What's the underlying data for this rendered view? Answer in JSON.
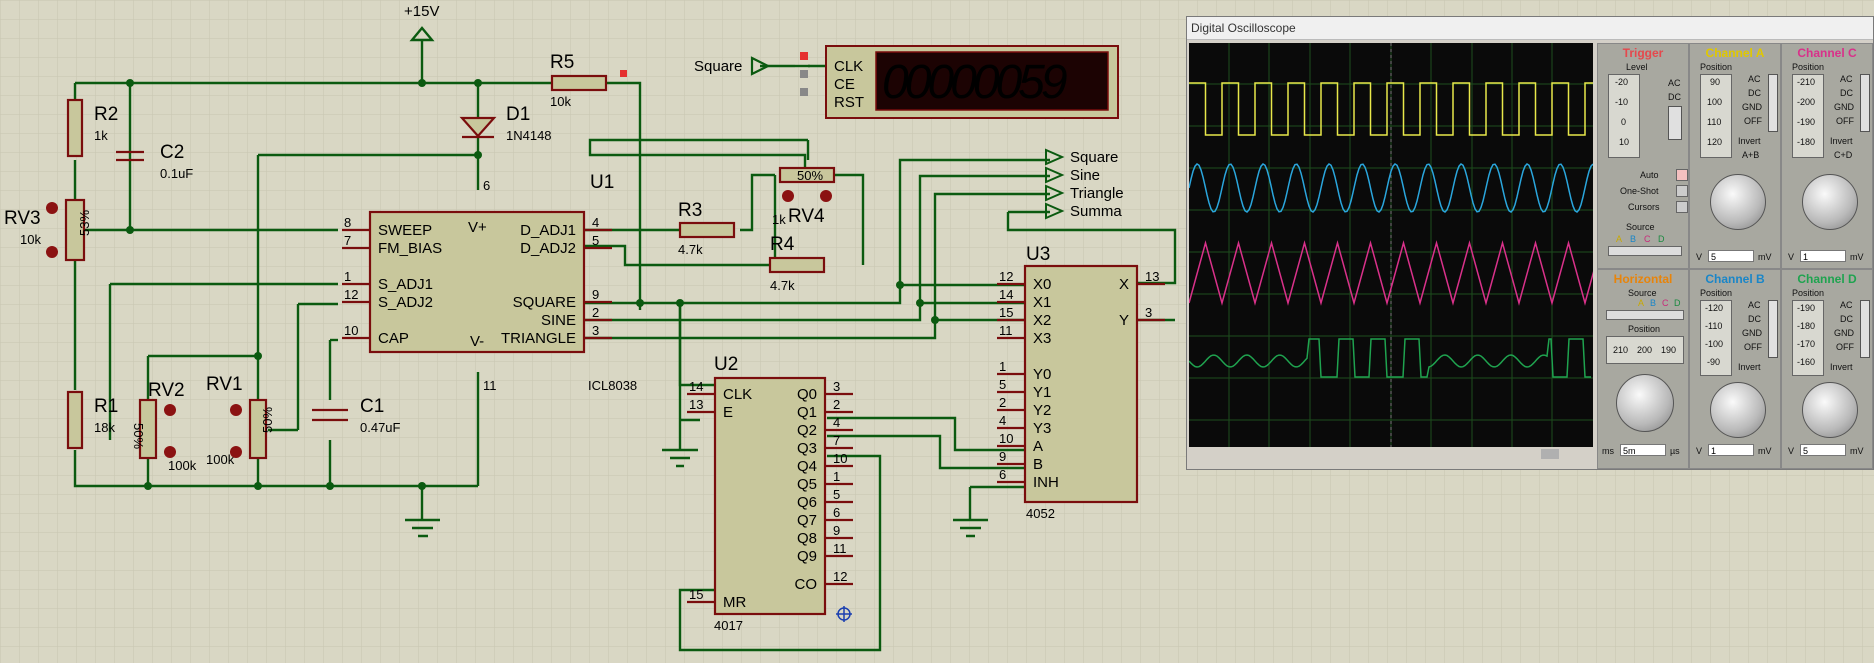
{
  "schematic": {
    "power_label": "+15V",
    "components": {
      "R2": {
        "ref": "R2",
        "value": "1k"
      },
      "C2": {
        "ref": "C2",
        "value": "0.1uF"
      },
      "RV3": {
        "ref": "RV3",
        "value": "10k",
        "wiper": "53%"
      },
      "R1": {
        "ref": "R1",
        "value": "18k"
      },
      "RV2": {
        "ref": "RV2",
        "value": "100k",
        "wiper": "50%"
      },
      "RV1": {
        "ref": "RV1",
        "value": "100k",
        "wiper": "50%"
      },
      "C1": {
        "ref": "C1",
        "value": "0.47uF"
      },
      "D1": {
        "ref": "D1",
        "value": "1N4148"
      },
      "R5": {
        "ref": "R5",
        "value": "10k"
      },
      "R3": {
        "ref": "R3",
        "value": "4.7k"
      },
      "R4": {
        "ref": "R4",
        "value": "4.7k"
      },
      "RV4": {
        "ref": "RV4",
        "value": "1k",
        "wiper": "50%"
      }
    },
    "U1": {
      "ref": "U1",
      "part": "ICL8038",
      "pins_left": [
        {
          "num": "8",
          "name": "SWEEP"
        },
        {
          "num": "7",
          "name": "FM_BIAS"
        },
        {
          "num": "1",
          "name": "S_ADJ1"
        },
        {
          "num": "12",
          "name": "S_ADJ2"
        },
        {
          "num": "10",
          "name": "CAP"
        }
      ],
      "pins_right": [
        {
          "num": "4",
          "name": "D_ADJ1"
        },
        {
          "num": "5",
          "name": "D_ADJ2"
        },
        {
          "num": "9",
          "name": "SQUARE"
        },
        {
          "num": "2",
          "name": "SINE"
        },
        {
          "num": "3",
          "name": "TRIANGLE"
        }
      ],
      "vplus": "V+",
      "vminus": "V-",
      "pin_top": "6",
      "pin_bottom": "11"
    },
    "U2": {
      "ref": "U2",
      "part": "4017",
      "pins_left": [
        {
          "num": "14",
          "name": "CLK"
        },
        {
          "num": "13",
          "name": "E"
        },
        {
          "num": "15",
          "name": "MR"
        }
      ],
      "pins_right": [
        {
          "num": "3",
          "name": "Q0"
        },
        {
          "num": "2",
          "name": "Q1"
        },
        {
          "num": "4",
          "name": "Q2"
        },
        {
          "num": "7",
          "name": "Q3"
        },
        {
          "num": "10",
          "name": "Q4"
        },
        {
          "num": "1",
          "name": "Q5"
        },
        {
          "num": "5",
          "name": "Q6"
        },
        {
          "num": "6",
          "name": "Q7"
        },
        {
          "num": "9",
          "name": "Q8"
        },
        {
          "num": "11",
          "name": "Q9"
        },
        {
          "num": "12",
          "name": "CO"
        }
      ]
    },
    "U3": {
      "ref": "U3",
      "part": "4052",
      "pins_left": [
        {
          "num": "12",
          "name": "X0"
        },
        {
          "num": "14",
          "name": "X1"
        },
        {
          "num": "15",
          "name": "X2"
        },
        {
          "num": "11",
          "name": "X3"
        },
        {
          "num": "1",
          "name": "Y0"
        },
        {
          "num": "5",
          "name": "Y1"
        },
        {
          "num": "2",
          "name": "Y2"
        },
        {
          "num": "4",
          "name": "Y3"
        },
        {
          "num": "10",
          "name": "A"
        },
        {
          "num": "9",
          "name": "B"
        },
        {
          "num": "6",
          "name": "INH"
        }
      ],
      "pins_right": [
        {
          "num": "13",
          "name": "X"
        },
        {
          "num": "3",
          "name": "Y"
        }
      ]
    },
    "counter": {
      "display": "00000059",
      "pins": [
        "CLK",
        "CE",
        "RST"
      ],
      "input_label": "Square"
    },
    "terminals": [
      "Square",
      "Sine",
      "Triangle",
      "Summa"
    ]
  },
  "oscilloscope": {
    "title": "Digital Oscilloscope",
    "trigger": {
      "title": "Trigger",
      "level": "Level",
      "ticks": [
        "-20",
        "-10",
        "0",
        "10"
      ],
      "coupling": [
        "AC",
        "DC"
      ],
      "modes": [
        "Auto",
        "One-Shot",
        "Cursors"
      ],
      "source": "Source",
      "source_opts": [
        "A",
        "B",
        "C",
        "D"
      ]
    },
    "channel_a": {
      "title": "Channel A",
      "position": "Position",
      "ticks": [
        "90",
        "100",
        "110",
        "120"
      ],
      "coupling": [
        "AC",
        "DC",
        "GND",
        "OFF"
      ],
      "invert": "Invert",
      "math": "A+B",
      "unit_v": "V",
      "value": "5",
      "unit_mv": "mV"
    },
    "channel_b": {
      "title": "Channel B",
      "position": "Position",
      "ticks": [
        "-120",
        "-110",
        "-100",
        "-90"
      ],
      "coupling": [
        "AC",
        "DC",
        "GND",
        "OFF"
      ],
      "invert": "Invert",
      "unit_v": "V",
      "value": "1",
      "unit_mv": "mV"
    },
    "channel_c": {
      "title": "Channel C",
      "position": "Position",
      "ticks": [
        "-210",
        "-200",
        "-190",
        "-180"
      ],
      "coupling": [
        "AC",
        "DC",
        "GND",
        "OFF"
      ],
      "invert": "Invert",
      "math": "C+D",
      "unit_v": "V",
      "value": "1",
      "unit_mv": "mV"
    },
    "channel_d": {
      "title": "Channel D",
      "position": "Position",
      "ticks": [
        "-190",
        "-180",
        "-170",
        "-160"
      ],
      "coupling": [
        "AC",
        "DC",
        "GND",
        "OFF"
      ],
      "invert": "Invert",
      "unit_v": "V",
      "value": "5",
      "unit_mv": "mV"
    },
    "horizontal": {
      "title": "Horizontal",
      "source": "Source",
      "source_opts": [
        "A",
        "B",
        "C",
        "D"
      ],
      "position": "Position",
      "position_ticks": [
        "210",
        "200",
        "190"
      ],
      "unit_ms": "ms",
      "value": "5m",
      "unit_us": "µs"
    },
    "colors": {
      "a": "#e8e84a",
      "b": "#2aa6dd",
      "c": "#d9318a",
      "d": "#1fa34f"
    }
  }
}
